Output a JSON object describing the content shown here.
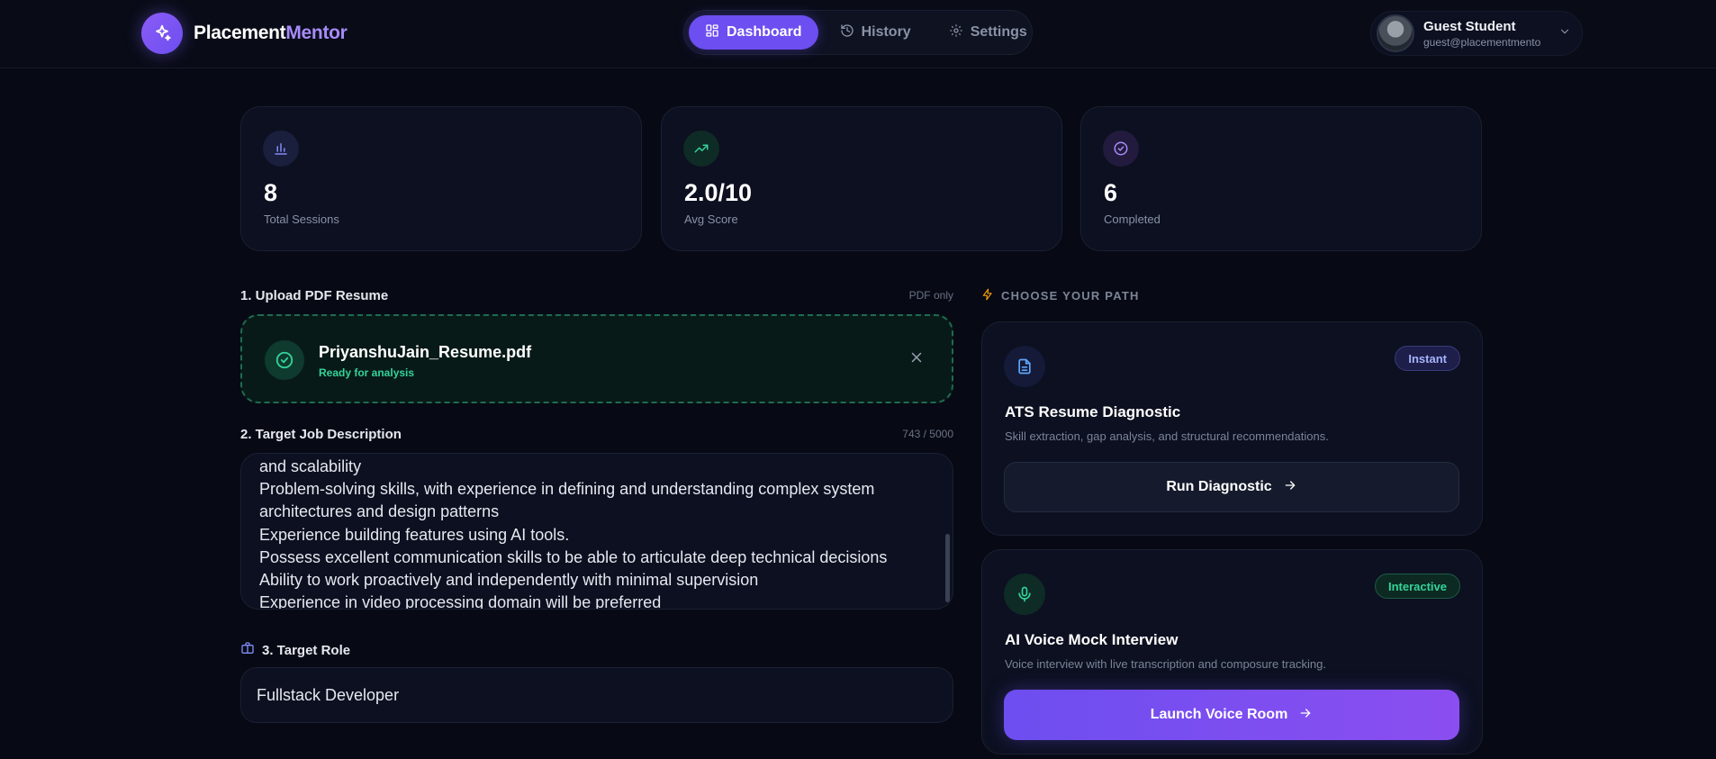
{
  "brand": {
    "name_part1": "Placement",
    "name_part2": "Mentor"
  },
  "nav": {
    "items": [
      {
        "label": "Dashboard",
        "icon": "dashboard-icon",
        "active": true
      },
      {
        "label": "History",
        "icon": "history-icon",
        "active": false
      },
      {
        "label": "Settings",
        "icon": "gear-icon",
        "active": false
      }
    ]
  },
  "user": {
    "name": "Guest Student",
    "email": "guest@placementmento"
  },
  "stats": [
    {
      "value": "8",
      "label": "Total Sessions",
      "icon": "bar-chart-icon",
      "color": "#818cf8"
    },
    {
      "value": "2.0/10",
      "label": "Avg Score",
      "icon": "trending-up-icon",
      "color": "#34d399"
    },
    {
      "value": "6",
      "label": "Completed",
      "icon": "check-circle-icon",
      "color": "#a78bfa"
    }
  ],
  "upload": {
    "label": "1. Upload PDF Resume",
    "meta": "PDF only",
    "filename": "PriyanshuJain_Resume.pdf",
    "status": "Ready for analysis"
  },
  "job_description": {
    "label": "2. Target Job Description",
    "counter": "743 / 5000",
    "lines": [
      "and scalability",
      "Problem-solving skills, with experience in defining and understanding complex system",
      "architectures and design patterns",
      "Experience building features using AI tools.",
      "Possess excellent communication skills to be able to articulate deep technical decisions",
      "Ability to work proactively and independently with minimal supervision",
      "Experience in video processing domain will be preferred"
    ]
  },
  "target_role": {
    "label": "3. Target Role",
    "value": "Fullstack Developer"
  },
  "paths": {
    "label": "CHOOSE YOUR PATH",
    "cards": [
      {
        "badge": "Instant",
        "title": "ATS Resume Diagnostic",
        "description": "Skill extraction, gap analysis, and structural recommendations.",
        "button": "Run Diagnostic",
        "icon": "document-icon"
      },
      {
        "badge": "Interactive",
        "title": "AI Voice Mock Interview",
        "description": "Voice interview with live transcription and composure tracking.",
        "button": "Launch Voice Room",
        "icon": "microphone-icon"
      }
    ]
  },
  "colors": {
    "accent": "#6d4ef0",
    "success": "#34d399",
    "background": "#070a14"
  }
}
